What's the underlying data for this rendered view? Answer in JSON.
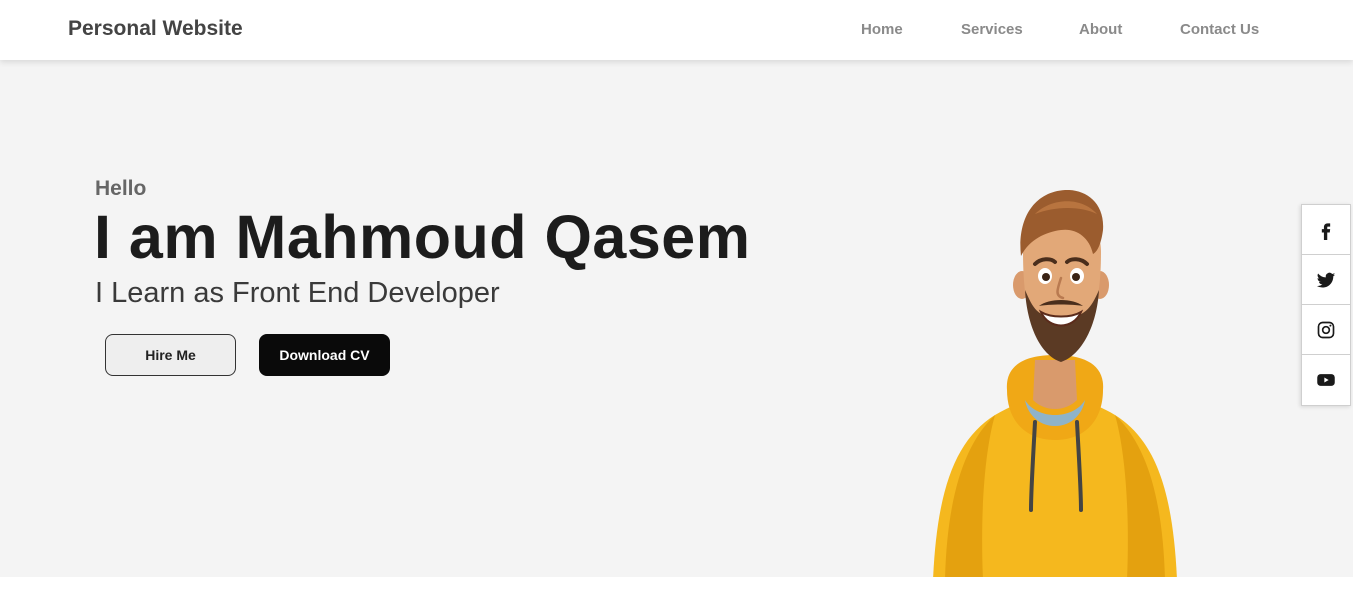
{
  "header": {
    "brand": "Personal Website",
    "nav": [
      {
        "label": "Home"
      },
      {
        "label": "Services"
      },
      {
        "label": "About"
      },
      {
        "label": "Contact Us"
      }
    ]
  },
  "hero": {
    "greeting": "Hello",
    "name": "I am Mahmoud Qasem",
    "role": "I Learn as Front End Developer",
    "buttons": {
      "hire": "Hire Me",
      "download": "Download CV"
    },
    "image": "cartoon-developer-avatar"
  },
  "social": [
    {
      "icon": "facebook-icon"
    },
    {
      "icon": "twitter-icon"
    },
    {
      "icon": "instagram-icon"
    },
    {
      "icon": "youtube-icon"
    }
  ],
  "colors": {
    "hero_background": "#f4f4f4",
    "primary_button": "#0a0a0a",
    "hoodie": "#f5b81e"
  }
}
